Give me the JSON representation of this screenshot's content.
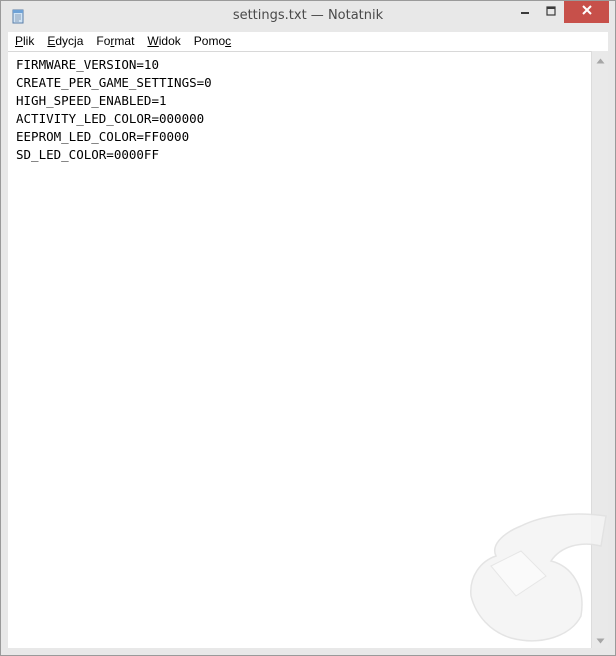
{
  "window": {
    "title": "settings.txt — Notatnik",
    "controls": {
      "minimize_icon": "minimize-icon",
      "maximize_icon": "maximize-icon",
      "close_icon": "close-icon",
      "close_color": "#c7504a"
    }
  },
  "menu": {
    "items": [
      {
        "pre": "",
        "acc": "P",
        "post": "lik"
      },
      {
        "pre": "",
        "acc": "E",
        "post": "dycja"
      },
      {
        "pre": "Fo",
        "acc": "r",
        "post": "mat"
      },
      {
        "pre": "",
        "acc": "W",
        "post": "idok"
      },
      {
        "pre": "Pomo",
        "acc": "c",
        "post": ""
      }
    ]
  },
  "editor": {
    "lines": [
      "FIRMWARE_VERSION=10",
      "CREATE_PER_GAME_SETTINGS=0",
      "HIGH_SPEED_ENABLED=1",
      "ACTIVITY_LED_COLOR=000000",
      "EEPROM_LED_COLOR=FF0000",
      "SD_LED_COLOR=0000FF"
    ]
  },
  "scrollbar": {
    "up_icon": "scroll-up-arrow-icon",
    "down_icon": "scroll-down-arrow-icon"
  }
}
